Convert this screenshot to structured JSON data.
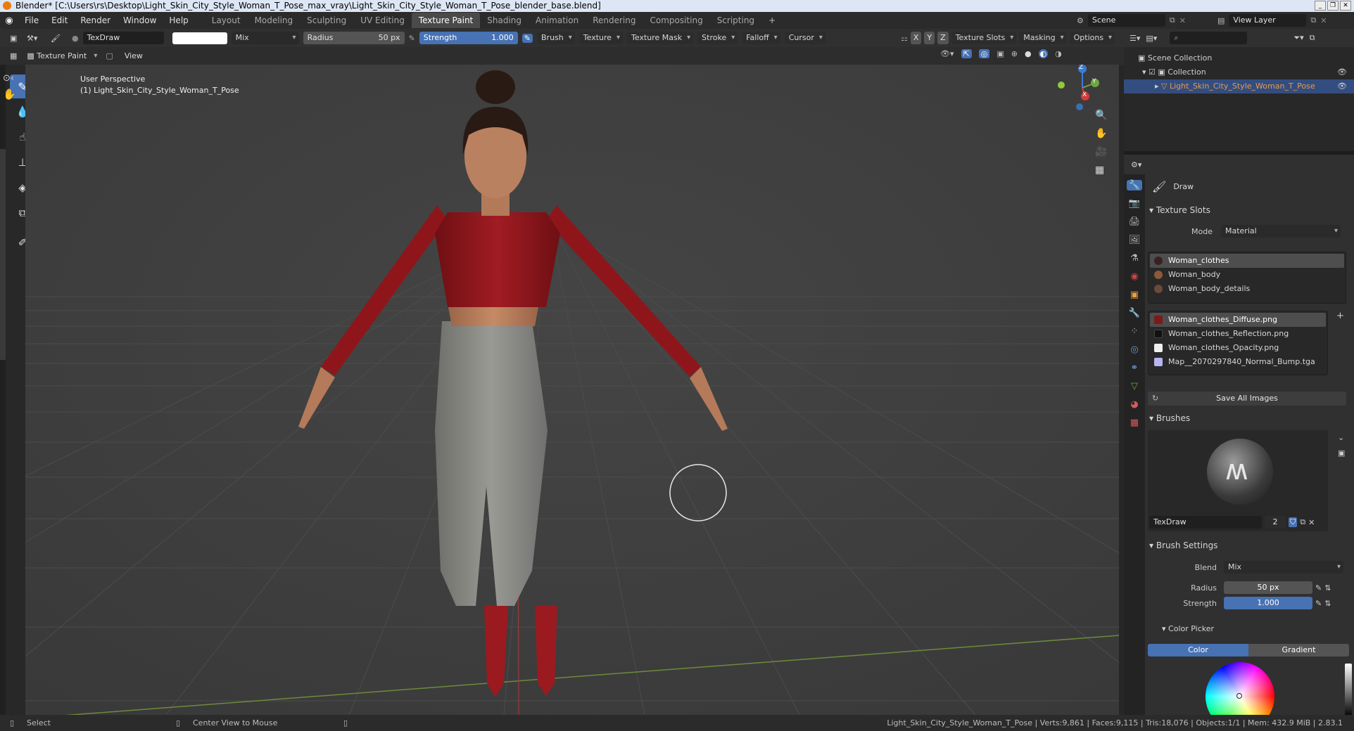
{
  "title": "Blender* [C:\\Users\\rs\\Desktop\\Light_Skin_City_Style_Woman_T_Pose_max_vray\\Light_Skin_City_Style_Woman_T_Pose_blender_base.blend]",
  "menu": [
    "File",
    "Edit",
    "Render",
    "Window",
    "Help"
  ],
  "workspaces": [
    "Layout",
    "Modeling",
    "Sculpting",
    "UV Editing",
    "Texture Paint",
    "Shading",
    "Animation",
    "Rendering",
    "Compositing",
    "Scripting"
  ],
  "active_workspace_index": 4,
  "scene": {
    "name": "Scene",
    "view_layer": "View Layer"
  },
  "toolheader": {
    "brush_name": "TexDraw",
    "blend": "Mix",
    "radius_label": "Radius",
    "radius_value": "50 px",
    "strength_label": "Strength",
    "strength_value": "1.000",
    "menus": [
      "Brush",
      "Texture",
      "Texture Mask",
      "Stroke",
      "Falloff",
      "Cursor"
    ],
    "axes": [
      "X",
      "Y",
      "Z"
    ],
    "right_menus": [
      "Texture Slots",
      "Masking",
      "Options"
    ]
  },
  "viewport_header": {
    "mode": "Texture Paint",
    "view_menu": "View"
  },
  "viewport": {
    "perspective": "User Perspective",
    "object": "(1) Light_Skin_City_Style_Woman_T_Pose",
    "gizmo_axes": [
      "Z",
      "Y",
      "X"
    ]
  },
  "outliner": {
    "root": "Scene Collection",
    "collection": "Collection",
    "object": "Light_Skin_City_Style_Woman_T_Pose"
  },
  "properties": {
    "tool_name": "Draw",
    "texture_slots_title": "Texture Slots",
    "mode_label": "Mode",
    "mode_value": "Material",
    "materials": [
      {
        "name": "Woman_clothes",
        "color": "#3a2020",
        "selected": true
      },
      {
        "name": "Woman_body",
        "color": "#8a5a3a",
        "selected": false
      },
      {
        "name": "Woman_body_details",
        "color": "#6a4a3a",
        "selected": false
      }
    ],
    "images": [
      {
        "name": "Woman_clothes_Diffuse.png",
        "color": "#7a1a1a",
        "selected": true
      },
      {
        "name": "Woman_clothes_Reflection.png",
        "color": "#111111",
        "selected": false
      },
      {
        "name": "Woman_clothes_Opacity.png",
        "color": "#f0f0f0",
        "selected": false
      },
      {
        "name": "Map__2070297840_Normal_Bump.tga",
        "color": "#b7b4f3",
        "selected": false
      }
    ],
    "save_all": "Save All Images",
    "brushes_title": "Brushes",
    "brush_name": "TexDraw",
    "brush_users": "2",
    "brush_settings_title": "Brush Settings",
    "blend_label": "Blend",
    "blend_value": "Mix",
    "radius_label": "Radius",
    "radius_value": "50 px",
    "strength_label": "Strength",
    "strength_value": "1.000",
    "color_picker_title": "Color Picker",
    "color_tab": "Color",
    "gradient_tab": "Gradient"
  },
  "status": {
    "select": "Select",
    "center_view": "Center View to Mouse",
    "stats": "Light_Skin_City_Style_Woman_T_Pose | Verts:9,861 | Faces:9,115 | Tris:18,076 | Objects:1/1 | Mem: 432.9 MiB | 2.83.1"
  },
  "colors": {
    "accent": "#4772b3",
    "brush_color": "#ffffff",
    "top_red": "#8e1a1e",
    "pants_gray": "#8a8a84"
  }
}
